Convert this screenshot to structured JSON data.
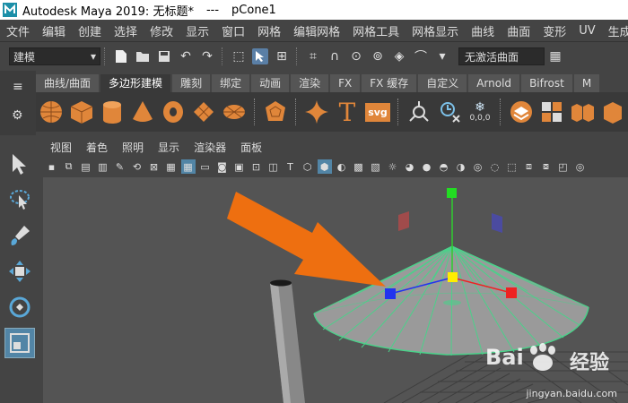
{
  "window": {
    "title": "Autodesk Maya 2019: 无标题*",
    "separator": "---",
    "object": "pCone1"
  },
  "menu": [
    "文件",
    "编辑",
    "创建",
    "选择",
    "修改",
    "显示",
    "窗口",
    "网格",
    "编辑网格",
    "网格工具",
    "网格显示",
    "曲线",
    "曲面",
    "变形",
    "UV",
    "生成"
  ],
  "mode_selector": {
    "value": "建模"
  },
  "live_surface": "无激活曲面",
  "shelf_tabs": [
    {
      "label": "曲线/曲面",
      "active": false
    },
    {
      "label": "多边形建模",
      "active": true
    },
    {
      "label": "雕刻",
      "active": false
    },
    {
      "label": "绑定",
      "active": false
    },
    {
      "label": "动画",
      "active": false
    },
    {
      "label": "渲染",
      "active": false
    },
    {
      "label": "FX",
      "active": false
    },
    {
      "label": "FX 缓存",
      "active": false
    },
    {
      "label": "自定义",
      "active": false
    },
    {
      "label": "Arnold",
      "active": false
    },
    {
      "label": "Bifrost",
      "active": false
    },
    {
      "label": "M",
      "active": false
    }
  ],
  "shelf_icons": {
    "text_tool": "T",
    "svg_tool": "svg",
    "snowflake_label": "0,0,0"
  },
  "panel_menu": [
    "视图",
    "着色",
    "照明",
    "显示",
    "渲染器",
    "面板"
  ],
  "colors": {
    "accent_orange": "#e0863a",
    "selection_blue": "#5285a6",
    "wire_green": "#4bd18a",
    "arrow": "#ee6f10"
  },
  "watermark": {
    "brand_a": "Bai",
    "brand_b": "经验",
    "url": "jingyan.baidu.com"
  }
}
